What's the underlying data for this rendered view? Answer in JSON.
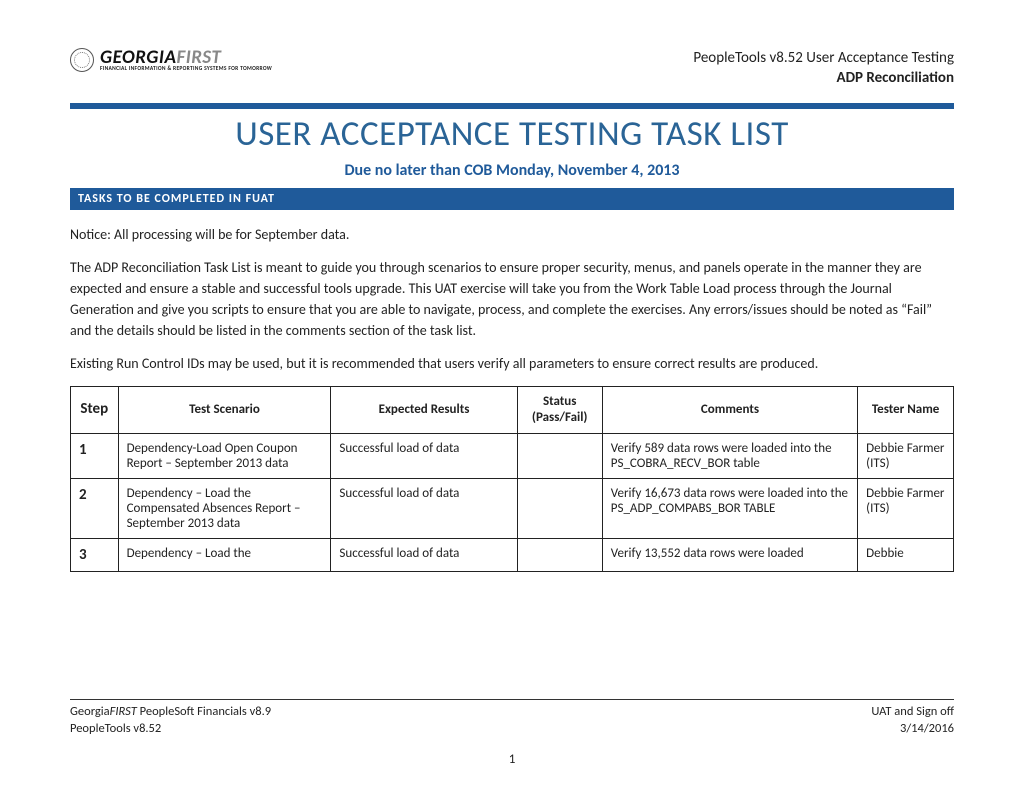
{
  "header": {
    "logo_main_a": "GEORGIA",
    "logo_main_b": "FIRST",
    "logo_sub": "FINANCIAL INFORMATION & REPORTING SYSTEMS FOR TOMORROW",
    "right_line1": "PeopleTools v8.52 User Acceptance Testing",
    "right_line2": "ADP Reconciliation"
  },
  "title": "USER ACCEPTANCE TESTING TASK LIST",
  "due": "Due no later than COB Monday, November 4, 2013",
  "section_bar": "TASKS TO BE COMPLETED IN FUAT",
  "paragraphs": {
    "p1": "Notice:  All processing will be for September data.",
    "p2": "The ADP Reconciliation Task List is meant to guide you through scenarios to ensure proper security, menus, and panels operate in the manner they are expected and ensure a stable and successful tools upgrade.  This UAT exercise will take you from the Work Table Load process through the Journal Generation and give you scripts to ensure that you are able to navigate, process, and complete the exercises.  Any errors/issues should be noted as “Fail” and the details should be listed in the comments section of the task list.",
    "p3": "Existing Run Control IDs may be used, but it is recommended that users verify all parameters to ensure correct results are produced."
  },
  "table": {
    "headers": {
      "step": "Step",
      "scenario": "Test Scenario",
      "expected": "Expected Results",
      "status": "Status (Pass/Fail)",
      "comments": "Comments",
      "tester": "Tester Name"
    },
    "rows": [
      {
        "step": "1",
        "scenario": "Dependency-Load Open Coupon Report – September 2013 data",
        "expected": "Successful load of data",
        "status": "",
        "comments": "Verify 589 data rows were loaded into the PS_COBRA_RECV_BOR table",
        "tester": "Debbie Farmer (ITS)"
      },
      {
        "step": "2",
        "scenario": "Dependency – Load the Compensated Absences Report – September 2013 data",
        "expected": "Successful load of data",
        "status": "",
        "comments": "Verify 16,673 data rows were loaded into the PS_ADP_COMPABS_BOR TABLE",
        "tester": "Debbie Farmer (ITS)"
      },
      {
        "step": "3",
        "scenario": "Dependency – Load the",
        "expected": "Successful load of data",
        "status": "",
        "comments": "Verify 13,552 data rows were loaded",
        "tester": "Debbie"
      }
    ]
  },
  "footer": {
    "left1a": "Georgia",
    "left1b": "FIRST",
    "left1c": " PeopleSoft Financials v8.9",
    "left2": "PeopleTools v8.52",
    "right1": "UAT and Sign off",
    "right2": "3/14/2016",
    "page": "1"
  }
}
